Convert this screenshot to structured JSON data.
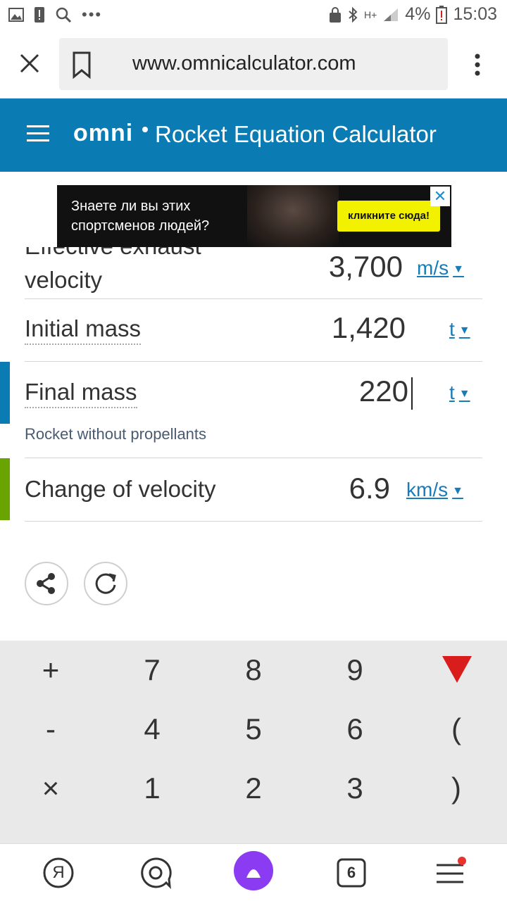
{
  "status_bar": {
    "battery_percent": "4%",
    "time": "15:03",
    "network": "H+",
    "more_dots": "•••"
  },
  "browser": {
    "url": "www.omnicalculator.com"
  },
  "header": {
    "logo": "omni",
    "title": "Rocket Equation Calculator",
    "color": "#0b7cb3"
  },
  "ad": {
    "text_line1": "Знаете ли вы этих",
    "text_line2": "спортсменов людей?",
    "cta": "кликните сюда!",
    "close": "✕"
  },
  "calculator": {
    "exhaust": {
      "label_line1": "Effective exhaust",
      "label_line2": "velocity",
      "value": "3,700",
      "unit": "m/s"
    },
    "initial_mass": {
      "label": "Initial mass",
      "value": "1,420",
      "unit": "t"
    },
    "final_mass": {
      "label": "Final mass",
      "value": "220",
      "unit": "t",
      "hint": "Rocket without propellants"
    },
    "delta_v": {
      "label": "Change of velocity",
      "value": "6.9",
      "unit": "km/s"
    },
    "accent_final": "#0b7cb3",
    "accent_result": "#6aa400"
  },
  "keyboard": {
    "row1": [
      "+",
      "7",
      "8",
      "9"
    ],
    "row2": [
      "-",
      "4",
      "5",
      "6",
      "("
    ],
    "row3": [
      "×",
      "1",
      "2",
      "3",
      ")"
    ]
  },
  "bottom_nav": {
    "tabs_count": "6",
    "yandex_letter": "Я"
  }
}
